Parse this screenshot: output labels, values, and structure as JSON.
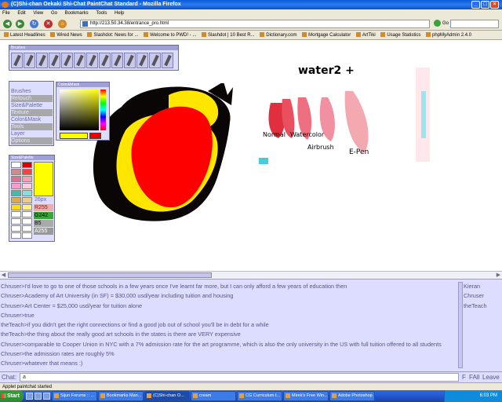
{
  "window": {
    "title": "(C)Shi-chan Oekaki Shi-Chat PaintChat Standard - Mozilla Firefox"
  },
  "menu": [
    "File",
    "Edit",
    "View",
    "Go",
    "Bookmarks",
    "Tools",
    "Help"
  ],
  "nav": {
    "url": "http://213.50.34.38/entrance_pro.html",
    "go_label": "Go"
  },
  "bookmarks": [
    "Latest Headlines",
    "Wired News",
    "Slashdot: News for ...",
    "Welcome to PWD! - ...",
    "Slashdot | 10 Best R...",
    "Dictionary.com",
    "Mortgage Calculator",
    "ArtTiki",
    "Usage Statistics",
    "phpMyAdmin 2.4.0"
  ],
  "brushes": {
    "title": "Brushes"
  },
  "menu_panel": {
    "items": [
      "Brushes",
      "Retouch",
      "Size&Palette",
      "Texture",
      "Color&Mask",
      "Tools",
      "Layer",
      "Options"
    ]
  },
  "colormask": {
    "title": "Color&Mask"
  },
  "sizepal": {
    "title": "Size&Palette",
    "size": "26px",
    "r": "R255",
    "g": "G242",
    "b": "B5",
    "a": "A255"
  },
  "palette": [
    [
      "#ffffff",
      "#dd0000"
    ],
    [
      "#d08a8a",
      "#ee4444"
    ],
    [
      "#e07090",
      "#f0a0b0"
    ],
    [
      "#ff99cc",
      "#ffccdd"
    ],
    [
      "#44bbaa",
      "#88dddd"
    ],
    [
      "#ddaa44",
      "#eecc88"
    ],
    [
      "#ffdd00",
      "#ffee88"
    ],
    [
      "#ffffff",
      "#ffffff"
    ],
    [
      "#ffffff",
      "#ffffff"
    ],
    [
      "#ffffff",
      "#ffffff"
    ],
    [
      "#ffffff",
      "#ffffff"
    ]
  ],
  "ref": {
    "title": "water2 +",
    "normal": "Normal",
    "watercolor": "Watercolor",
    "airbrush": "Airbrush",
    "epen": "E-Pen"
  },
  "chat": {
    "lines": [
      "Chruser>I'd love to go to one of those schools in a few years once I've learnt far more, but I can only afford a few years of education then",
      "Chruser>Academy of Art University (in SF) = $30,000 usd/year including tuition and housing",
      "Chruser>Art Center = $25,000 usd/year for tuition alone",
      "Chruser>true",
      "theTeach>if you didn't get the right connections or find a good job out of school you'll be in debt for a while",
      "theTeach>the thing about the really good art schools in the states is there are VERY expensive",
      "Chruser>comparable to Cooper Union in NYC with a 7% admission rate for the art programme, which is also the only university in the US with full tuition offered to all students",
      "Chruser>the admission rates are roughly 5%",
      "Chruser>whatever that means :)"
    ],
    "users": [
      "Kieran",
      "Chruser",
      "theTeach"
    ],
    "label": "Chat:",
    "input_value": "a",
    "buttons": {
      "f": "F",
      "fall": "FAll",
      "leave": "Leave"
    }
  },
  "status": "Applet paintchat started",
  "taskbar": {
    "start": "Start",
    "tasks": [
      "Sijun Forums :: ...",
      "Bookmarks Man...",
      "(C)Shi-chan O...",
      "cream",
      "CG Curriculum.t...",
      "Mirek's Free Win...",
      "Adobe Photoshop"
    ],
    "clock": "6:03 PM"
  }
}
